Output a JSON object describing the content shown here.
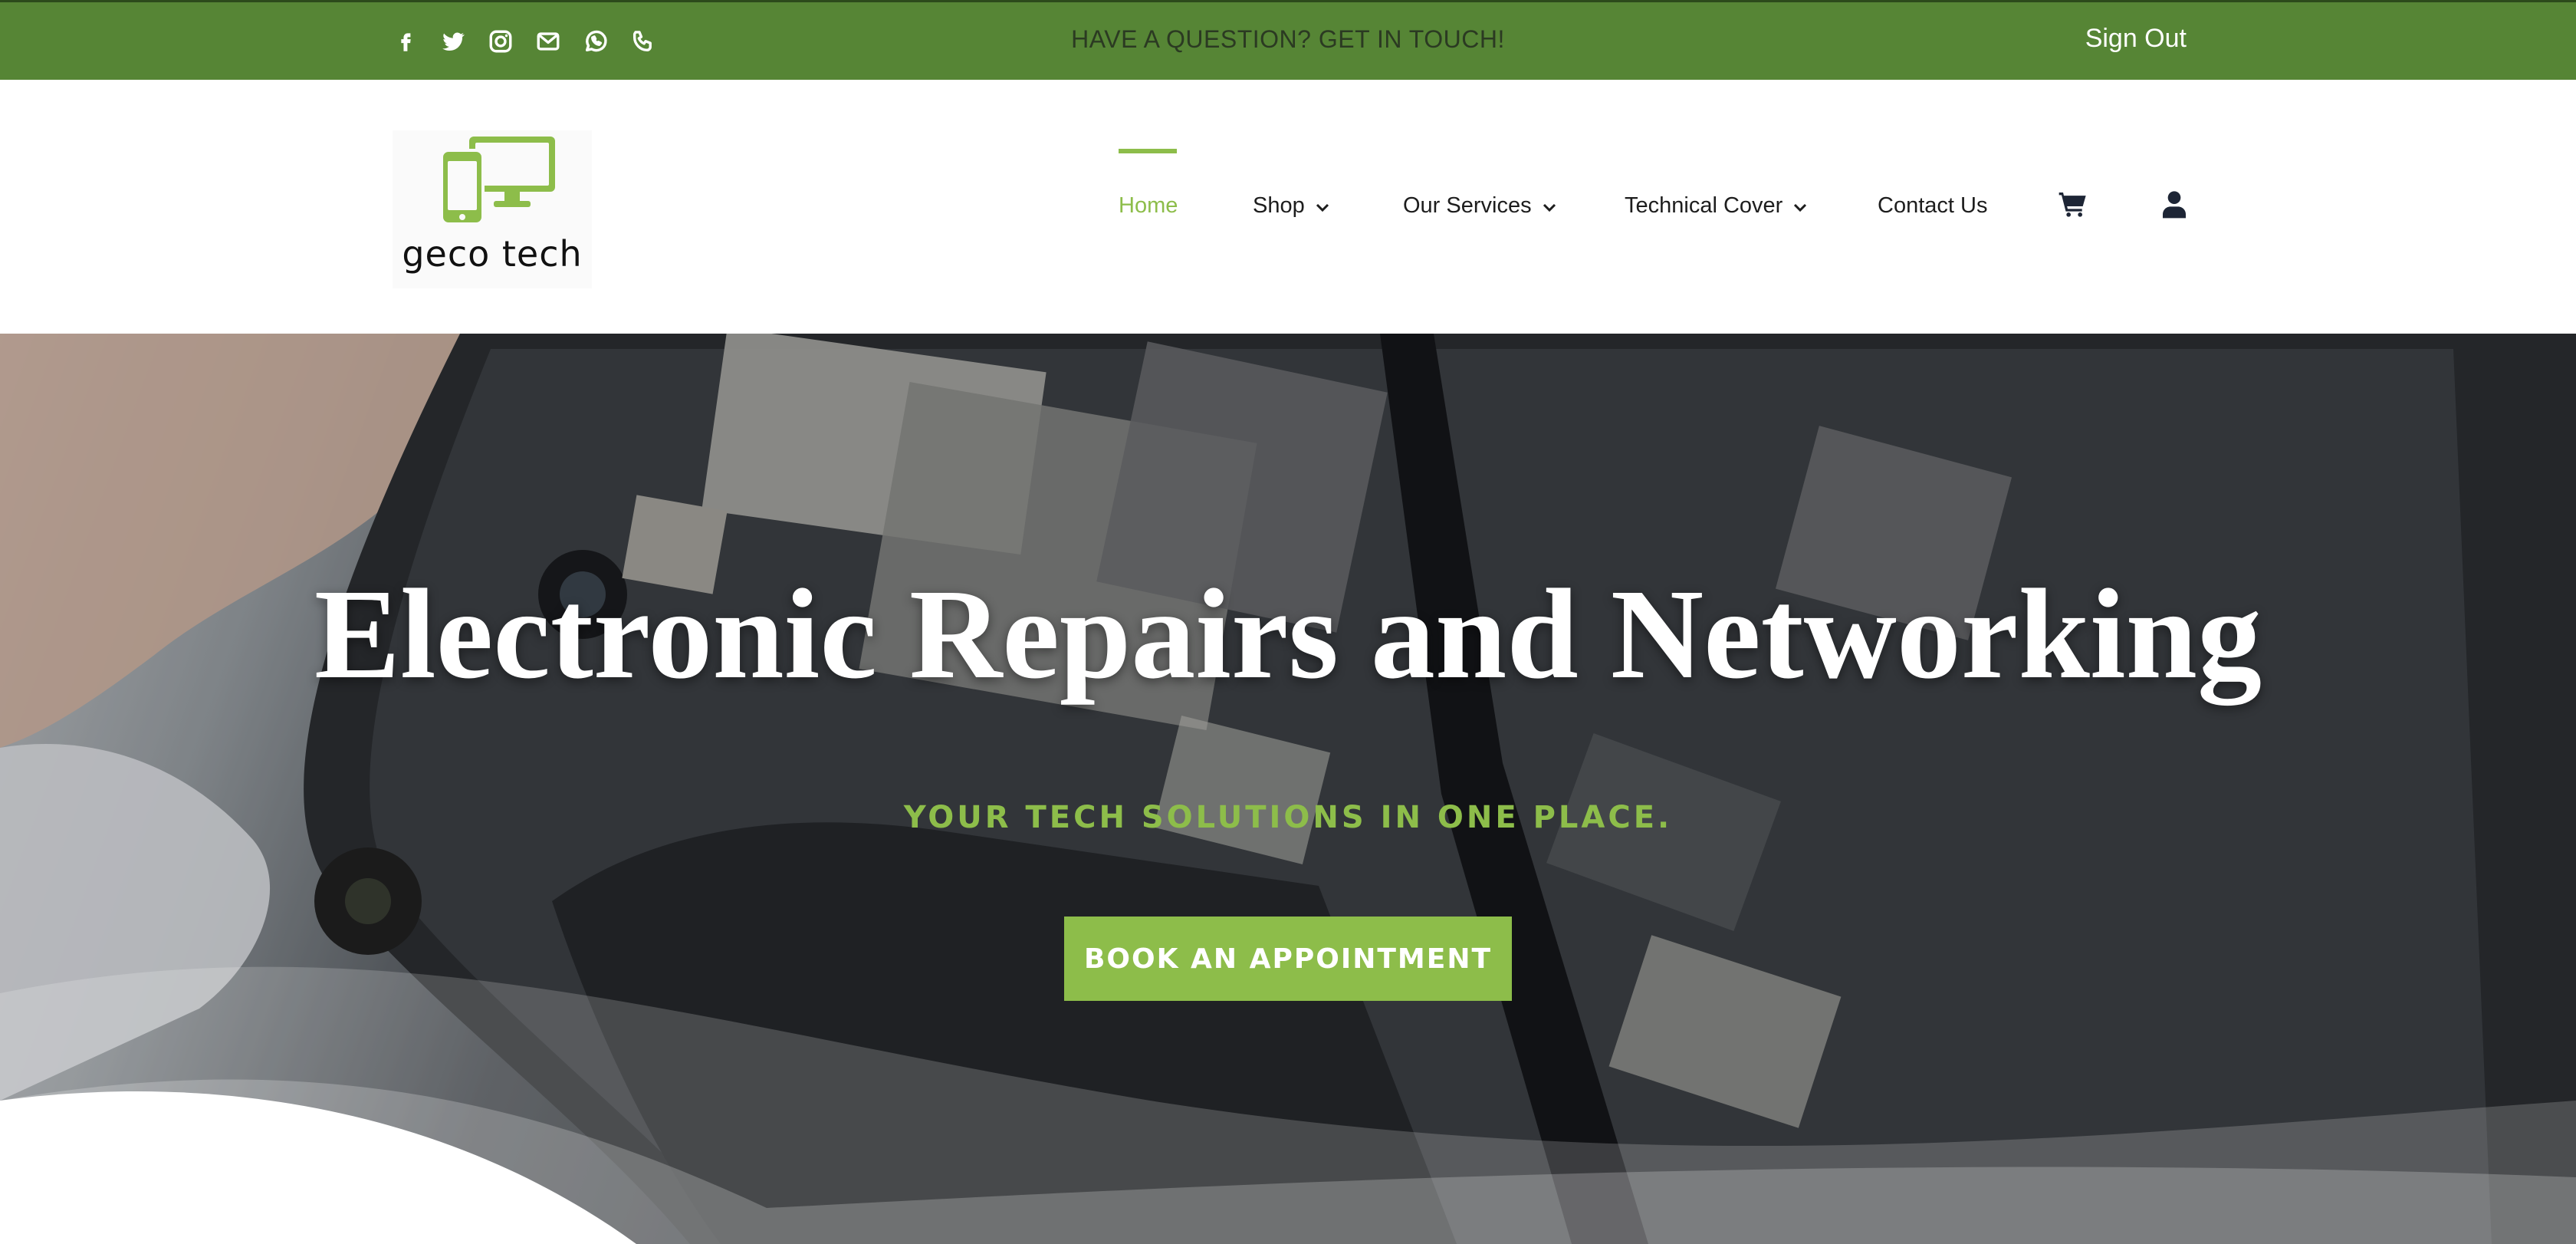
{
  "topbar": {
    "question": "HAVE A QUESTION? GET IN TOUCH!",
    "sign_out": "Sign Out",
    "social_icons": [
      "facebook-icon",
      "twitter-icon",
      "instagram-icon",
      "mail-icon",
      "whatsapp-icon",
      "phone-icon"
    ],
    "background": "#568535"
  },
  "header": {
    "logo_text": "geco tech",
    "nav": {
      "home": "Home",
      "shop": "Shop",
      "services": "Our Services",
      "technical_cover": "Technical Cover",
      "contact": "Contact Us"
    },
    "icons": [
      "cart-icon",
      "user-icon"
    ]
  },
  "hero": {
    "title": "Electronic Repairs and Networking",
    "subtitle": "YOUR TECH SOLUTIONS IN ONE PLACE.",
    "cta": "BOOK AN APPOINTMENT"
  },
  "colors": {
    "accent": "#8dbd4a",
    "topbar": "#568535"
  }
}
